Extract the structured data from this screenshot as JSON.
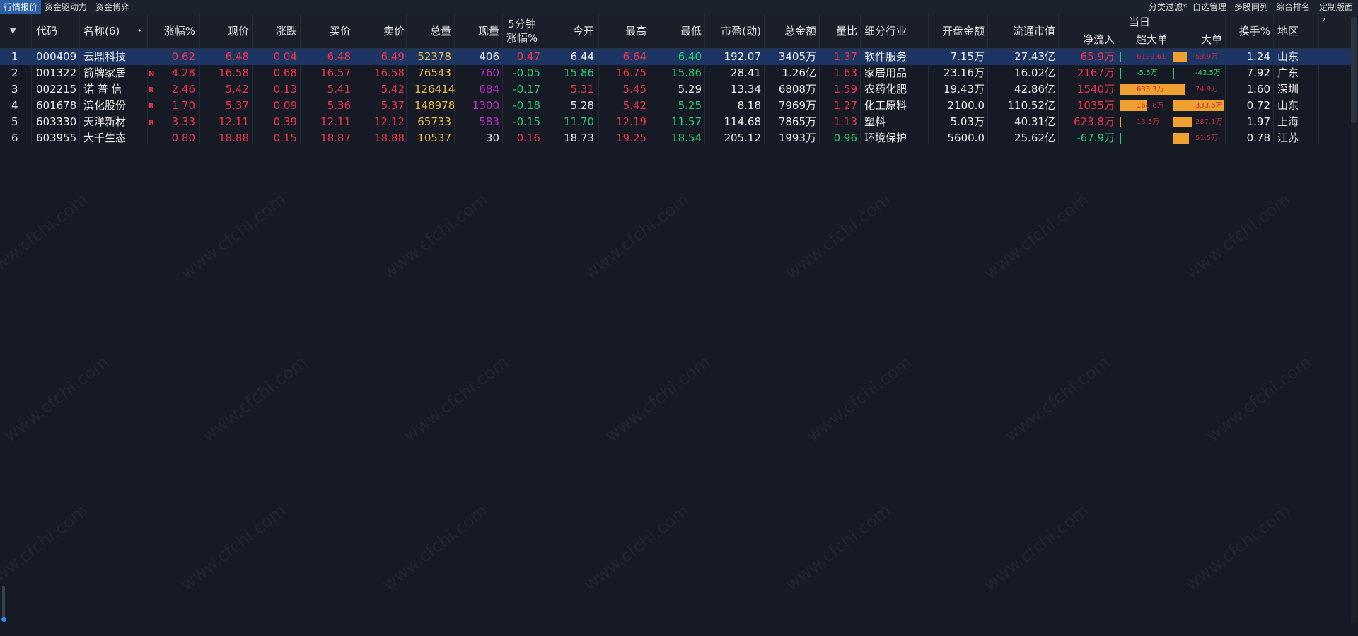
{
  "tabs": [
    "行情报价",
    "资金驱动力",
    "资金博弈"
  ],
  "tools": [
    "分类过滤*",
    "自选管理",
    "多股同列",
    "综合排名",
    "定制版面"
  ],
  "help": "?",
  "header": {
    "sort_arrow": "▼",
    "code": "代码",
    "name": "名称(6)",
    "dot": "•",
    "pct": "涨幅%",
    "price": "现价",
    "change": "涨跌",
    "bid": "买价",
    "ask": "卖价",
    "volume": "总量",
    "cur_vol": "现量",
    "min5_a": "5分钟",
    "min5_b": "涨幅%",
    "open": "今开",
    "high": "最高",
    "low": "最低",
    "pe": "市盈(动)",
    "amount": "总金额",
    "vol_ratio": "量比",
    "industry": "细分行业",
    "open_amount": "开盘金额",
    "float_cap": "流通市值",
    "day_group": "当日",
    "net_inflow": "净流入",
    "super_large": "超大单",
    "large": "大单",
    "turnover": "换手%",
    "region": "地区"
  },
  "rows": [
    {
      "idx": "1",
      "code": "000409",
      "name": "云鼎科技",
      "flag": "",
      "pct": "0.62",
      "price": "6.48",
      "change": "0.04",
      "bid": "6.48",
      "ask": "6.49",
      "volume": "52378",
      "cur_vol": "406",
      "min5": "0.47",
      "open": "6.44",
      "high": "6.64",
      "low": "6.40",
      "pe": "192.07",
      "amount": "3405万",
      "vol_ratio": "1.37",
      "industry": "软件服务",
      "open_amount": "7.15万",
      "float_cap": "27.43亿",
      "net_inflow": "65.9万",
      "super_large": "6129.61",
      "large": "53.9万",
      "turnover": "1.24",
      "region": "山东",
      "colors": {
        "pct": "red",
        "price": "red",
        "change": "red",
        "bid": "red",
        "ask": "red",
        "cur_vol": "white",
        "min5": "red",
        "open": "white",
        "high": "red",
        "low": "green",
        "vol_ratio": "red",
        "net_inflow": "red",
        "super_large": "red",
        "large": "red"
      }
    },
    {
      "idx": "2",
      "code": "001322",
      "name": "箭牌家居",
      "flag": "N",
      "pct": "4.28",
      "price": "16.58",
      "change": "0.68",
      "bid": "16.57",
      "ask": "16.58",
      "volume": "76543",
      "cur_vol": "760",
      "min5": "-0.05",
      "open": "15.86",
      "high": "16.75",
      "low": "15.86",
      "pe": "28.41",
      "amount": "1.26亿",
      "vol_ratio": "1.63",
      "industry": "家居用品",
      "open_amount": "23.16万",
      "float_cap": "16.02亿",
      "net_inflow": "2167万",
      "super_large": "-5.5万",
      "large": "-43.5万",
      "turnover": "7.92",
      "region": "广东",
      "colors": {
        "pct": "red",
        "price": "red",
        "change": "red",
        "bid": "red",
        "ask": "red",
        "cur_vol": "purple",
        "min5": "green",
        "open": "green",
        "high": "red",
        "low": "green",
        "vol_ratio": "red",
        "net_inflow": "red",
        "super_large": "green",
        "large": "green"
      }
    },
    {
      "idx": "3",
      "code": "002215",
      "name": "诺 普 信",
      "flag": "R",
      "pct": "2.46",
      "price": "5.42",
      "change": "0.13",
      "bid": "5.41",
      "ask": "5.42",
      "volume": "126414",
      "cur_vol": "684",
      "min5": "-0.17",
      "open": "5.31",
      "high": "5.45",
      "low": "5.29",
      "pe": "13.34",
      "amount": "6808万",
      "vol_ratio": "1.59",
      "industry": "农药化肥",
      "open_amount": "19.43万",
      "float_cap": "42.86亿",
      "net_inflow": "1540万",
      "super_large": "633.3万",
      "large": "74.9万",
      "turnover": "1.60",
      "region": "深圳",
      "colors": {
        "pct": "red",
        "price": "red",
        "change": "red",
        "bid": "red",
        "ask": "red",
        "cur_vol": "purple",
        "min5": "green",
        "open": "red",
        "high": "red",
        "low": "white",
        "vol_ratio": "red",
        "net_inflow": "red",
        "super_large": "red",
        "large": "red"
      }
    },
    {
      "idx": "4",
      "code": "601678",
      "name": "滨化股份",
      "flag": "R",
      "pct": "1.70",
      "price": "5.37",
      "change": "0.09",
      "bid": "5.36",
      "ask": "5.37",
      "volume": "148978",
      "cur_vol": "1300",
      "min5": "-0.18",
      "open": "5.28",
      "high": "5.42",
      "low": "5.25",
      "pe": "8.18",
      "amount": "7969万",
      "vol_ratio": "1.27",
      "industry": "化工原料",
      "open_amount": "2100.0",
      "float_cap": "110.52亿",
      "net_inflow": "1035万",
      "super_large": "168.8万",
      "large": "333.6万",
      "turnover": "0.72",
      "region": "山东",
      "colors": {
        "pct": "red",
        "price": "red",
        "change": "red",
        "bid": "red",
        "ask": "red",
        "cur_vol": "purple",
        "min5": "green",
        "open": "white",
        "high": "red",
        "low": "green",
        "vol_ratio": "red",
        "net_inflow": "red",
        "super_large": "red",
        "large": "red"
      }
    },
    {
      "idx": "5",
      "code": "603330",
      "name": "天洋新材",
      "flag": "R",
      "pct": "3.33",
      "price": "12.11",
      "change": "0.39",
      "bid": "12.11",
      "ask": "12.12",
      "volume": "65733",
      "cur_vol": "583",
      "min5": "-0.15",
      "open": "11.70",
      "high": "12.19",
      "low": "11.57",
      "pe": "114.68",
      "amount": "7865万",
      "vol_ratio": "1.13",
      "industry": "塑料",
      "open_amount": "5.03万",
      "float_cap": "40.31亿",
      "net_inflow": "623.8万",
      "super_large": "13.5万",
      "large": "287.1万",
      "turnover": "1.97",
      "region": "上海",
      "colors": {
        "pct": "red",
        "price": "red",
        "change": "red",
        "bid": "red",
        "ask": "red",
        "cur_vol": "purple",
        "min5": "green",
        "open": "green",
        "high": "red",
        "low": "green",
        "vol_ratio": "red",
        "net_inflow": "red",
        "super_large": "red",
        "large": "red"
      }
    },
    {
      "idx": "6",
      "code": "603955",
      "name": "大千生态",
      "flag": "",
      "pct": "0.80",
      "price": "18.88",
      "change": "0.15",
      "bid": "18.87",
      "ask": "18.88",
      "volume": "10537",
      "cur_vol": "30",
      "min5": "0.16",
      "open": "18.73",
      "high": "19.25",
      "low": "18.54",
      "pe": "205.12",
      "amount": "1993万",
      "vol_ratio": "0.96",
      "industry": "环境保护",
      "open_amount": "5600.0",
      "float_cap": "25.62亿",
      "net_inflow": "-67.9万",
      "super_large": "",
      "large": "51.5万",
      "turnover": "0.78",
      "region": "江苏",
      "colors": {
        "pct": "red",
        "price": "red",
        "change": "red",
        "bid": "red",
        "ask": "red",
        "cur_vol": "white",
        "min5": "red",
        "open": "white",
        "high": "red",
        "low": "green",
        "vol_ratio": "green",
        "net_inflow": "green",
        "super_large": "red",
        "large": "red"
      }
    }
  ],
  "bars": [
    {
      "super_level": 0.0,
      "super_sign": "neg",
      "large_level": 0.28,
      "large_sign": "pos"
    },
    {
      "super_level": 0.0,
      "super_sign": "neg",
      "large_level": 0.0,
      "large_sign": "neg"
    },
    {
      "super_level": 1.0,
      "super_sign": "pos",
      "large_level": 0.12,
      "large_sign": "pos"
    },
    {
      "super_level": 0.42,
      "super_sign": "pos",
      "large_level": 1.0,
      "large_sign": "pos"
    },
    {
      "super_level": 0.0,
      "super_sign": "pos",
      "large_level": 0.38,
      "large_sign": "pos"
    },
    {
      "super_level": 0.0,
      "super_sign": "neg",
      "large_level": 0.32,
      "large_sign": "pos"
    }
  ],
  "watermark": "www.cfchi.com"
}
